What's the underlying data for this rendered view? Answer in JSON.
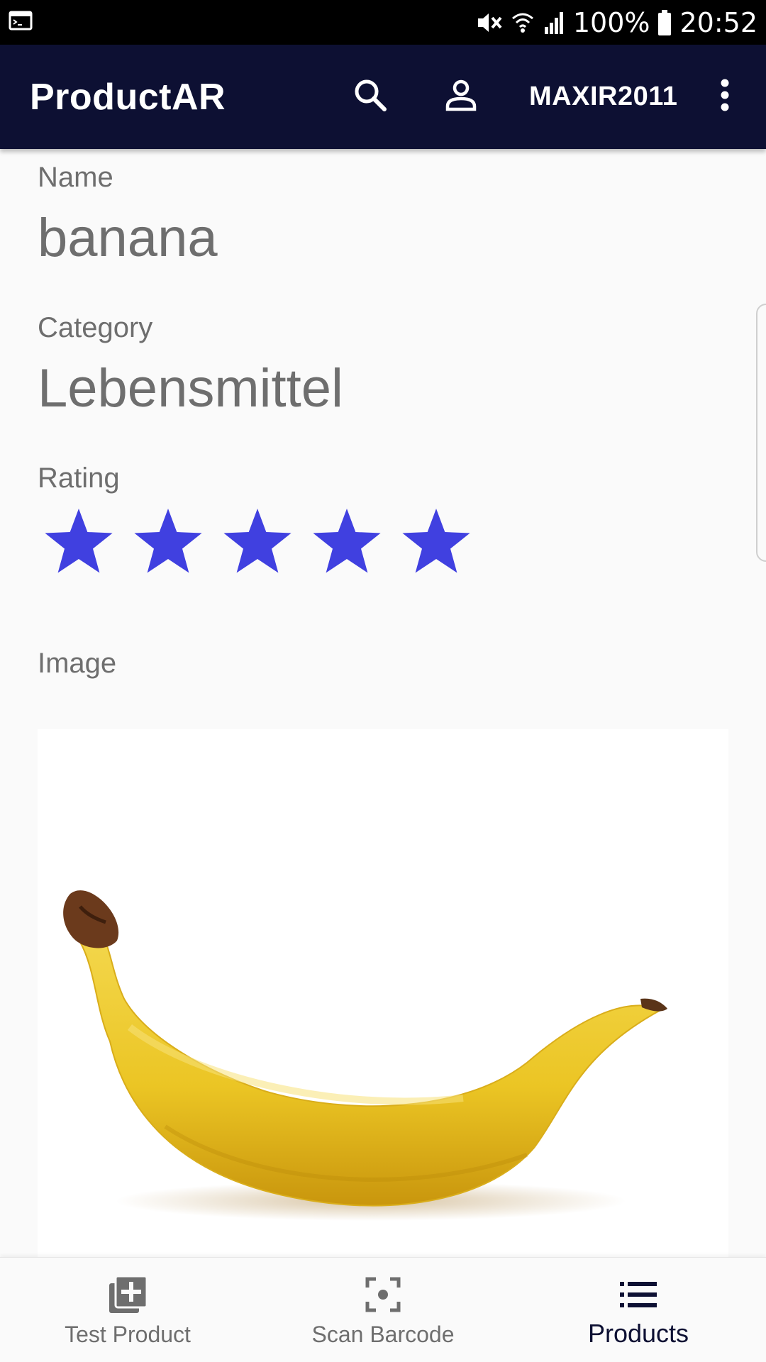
{
  "status_bar": {
    "battery_text": "100%",
    "time": "20:52",
    "icons": [
      "terminal-notification-icon",
      "mute-vibrate-icon",
      "wifi-icon",
      "signal-icon",
      "battery-icon"
    ]
  },
  "app_bar": {
    "title": "ProductAR",
    "username": "MAXIR2011",
    "icons": [
      "search-icon",
      "account-icon",
      "more-vert-icon"
    ]
  },
  "product": {
    "name_label": "Name",
    "name_value": "banana",
    "category_label": "Category",
    "category_value": "Lebensmittel",
    "rating_label": "Rating",
    "rating_value": 5,
    "rating_max": 5,
    "image_label": "Image",
    "image_subject": "banana-image"
  },
  "colors": {
    "app_bar": "#0d1033",
    "star": "#4040e0",
    "label_text": "#6e6e6e",
    "active_nav": "#0d1033"
  },
  "bottom_nav": {
    "items": [
      {
        "label": "Test Product",
        "icon": "add-to-library-icon",
        "active": false
      },
      {
        "label": "Scan Barcode",
        "icon": "scan-focus-icon",
        "active": false
      },
      {
        "label": "Products",
        "icon": "list-icon",
        "active": true
      }
    ]
  }
}
